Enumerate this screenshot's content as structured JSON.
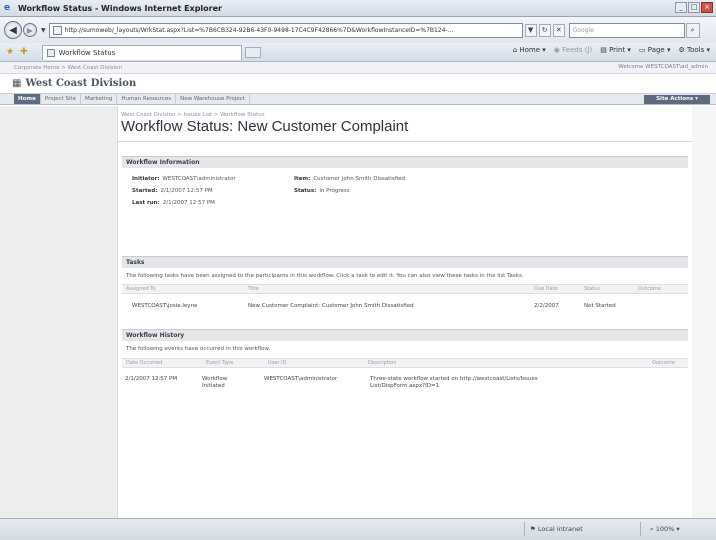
{
  "window": {
    "title": "Workflow Status - Windows Internet Explorer"
  },
  "addressbar": {
    "url": "http://sumoweb/_layouts/WrkStat.aspx?List=%7B6CB324-92B6-43F0-9498-17C4C9F42866%7D&WorkflowInstanceID=%7B124-...",
    "search_placeholder": "Google"
  },
  "commandbar": {
    "tab_label": "Workflow Status",
    "home": "Home",
    "feeds": "Feeds (J)",
    "print": "Print",
    "page": "Page",
    "tools": "Tools"
  },
  "sharepoint": {
    "global_breadcrumb": "Corporate Home > West Coast Division",
    "welcome": "Welcome WESTCOAST\\ad_admin",
    "site_name": "West Coast Division",
    "nav": [
      "Home",
      "Project Site",
      "Marketing",
      "Human Resources",
      "New Warehouse Project"
    ],
    "site_actions": "Site Actions"
  },
  "main": {
    "breadcrumb": "West Coast Division > Issues List > Workflow Status",
    "title": "Workflow Status: New Customer Complaint",
    "workflow_info": {
      "heading": "Workflow Information",
      "initiator_label": "Initiator:",
      "initiator": "WESTCOAST\\administrator",
      "started_label": "Started:",
      "started": "2/1/2007 12:57 PM",
      "lastrun_label": "Last run:",
      "lastrun": "2/1/2007 12:57 PM",
      "item_label": "Item:",
      "item": "Customer John Smith Dissatisfied",
      "status_label": "Status:",
      "status": "In Progress"
    },
    "tasks": {
      "heading": "Tasks",
      "description": "The following tasks have been assigned to the participants in this workflow. Click a task to edit it. You can also view these tasks in the list Tasks.",
      "columns": [
        "Assigned To",
        "Title",
        "Due Date",
        "Status",
        "Outcome"
      ],
      "rows": [
        {
          "assigned_to": "WESTCOAST\\josie.leyne",
          "title": "New Customer Complaint: Customer John Smith Dissatisfied",
          "due_date": "2/2/2007",
          "status": "Not Started",
          "outcome": ""
        }
      ]
    },
    "history": {
      "heading": "Workflow History",
      "description": "The following events have occurred in this workflow.",
      "columns": [
        "Date Occurred",
        "Event Type",
        "User ID",
        "Description",
        "Outcome"
      ],
      "rows": [
        {
          "date": "2/1/2007 12:57 PM",
          "event_type": "Workflow Initiated",
          "user_id": "WESTCOAST\\administrator",
          "description": "Three-state workflow started on http://westcoast/Lists/Issues List/DispForm.aspx?ID=1",
          "outcome": ""
        }
      ]
    }
  },
  "statusbar": {
    "zone": "Local intranet",
    "zoom": "100%"
  }
}
